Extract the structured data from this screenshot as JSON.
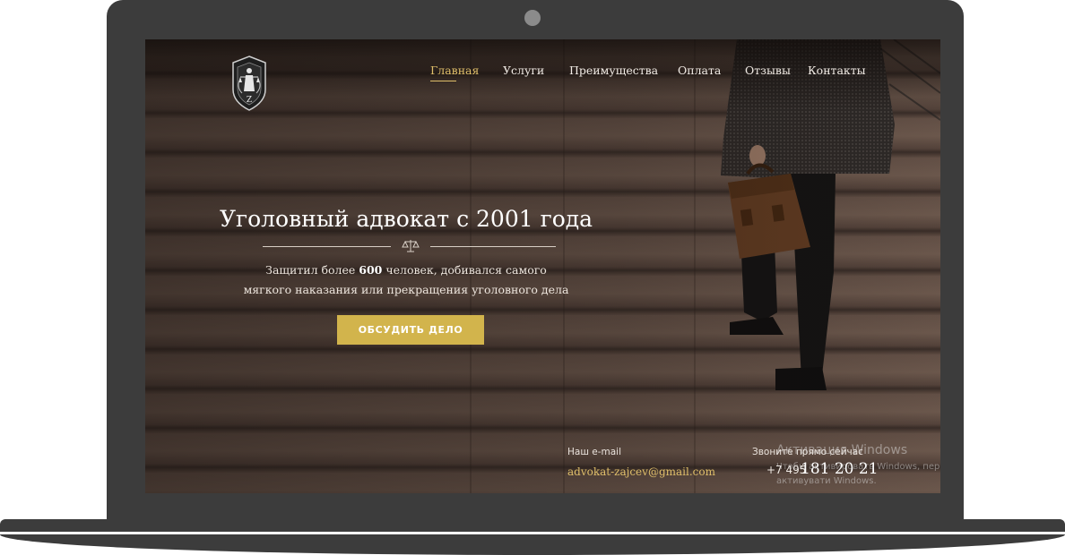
{
  "nav": {
    "items": [
      {
        "label": "Главная",
        "active": true
      },
      {
        "label": "Услуги",
        "active": false
      },
      {
        "label": "Преимущества",
        "active": false
      },
      {
        "label": "Оплата",
        "active": false
      },
      {
        "label": "Отзывы",
        "active": false
      },
      {
        "label": "Контакты",
        "active": false
      }
    ]
  },
  "logo": {
    "letter": "Z",
    "icon": "lady-justice-shield-icon"
  },
  "hero": {
    "title": "Уголовный адвокат с 2001 года",
    "divider_icon": "scales-icon",
    "subtitle_part1": "Защитил более ",
    "subtitle_bold": "600",
    "subtitle_part2": " человек, добивался самого",
    "subtitle_line2": "мягкого наказания или прекращения уголовного дела",
    "cta_label": "ОБСУДИТЬ ДЕЛО"
  },
  "contacts": {
    "email_label": "Наш e-mail",
    "email": "advokat-zajcev@gmail.com",
    "phone_label": "Звоните прямо сейчас",
    "phone_prefix": "+7 495",
    "phone_number": "181 20 21"
  },
  "watermark": {
    "line1": "Активация Windows",
    "line2": "Чтобы активировать Windows, перейдите к параметру \"Настройки\",",
    "line3": "активувати Windows."
  },
  "colors": {
    "accent": "#e0bf6a",
    "button": "#d2b44c",
    "frame": "#3c3c3c"
  }
}
